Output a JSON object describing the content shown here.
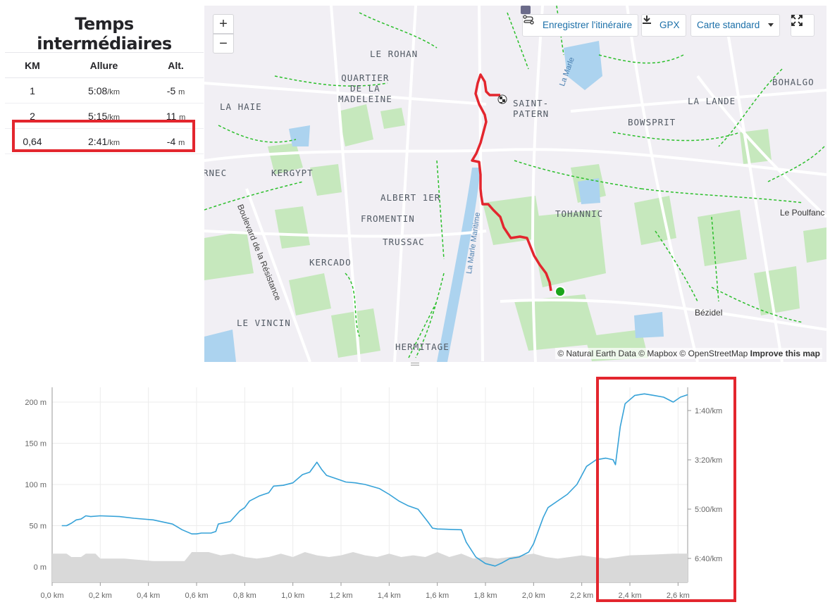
{
  "splits": {
    "title": "Temps intermédiaires",
    "columns": [
      "KM",
      "Allure",
      "Alt."
    ],
    "rows": [
      {
        "km": "1",
        "pace": "5:08",
        "pace_unit": "/km",
        "alt": "-5",
        "alt_unit": "m"
      },
      {
        "km": "2",
        "pace": "5:15",
        "pace_unit": "/km",
        "alt": "11",
        "alt_unit": "m"
      },
      {
        "km": "0,64",
        "pace": "2:41",
        "pace_unit": "/km",
        "alt": "-4",
        "alt_unit": "m"
      }
    ]
  },
  "map": {
    "zoom_in": "+",
    "zoom_out": "−",
    "save_route_label": "Enregistrer l'itinéraire",
    "gpx_label": "GPX",
    "map_style_label": "Carte standard",
    "labels": {
      "le_rohan": "LE ROHAN",
      "quartier": "QUARTIER",
      "de_la": "DE LA",
      "madeleine": "MADELEINE",
      "saint": "SAINT-",
      "patern": "PATERN",
      "bohalgo": "BOHALGO",
      "la_lande": "LA LANDE",
      "bowsprit": "BOWSPRIT",
      "la_haie": "LA HAIE",
      "rnec": "RNEC",
      "kergypt": "KERGYPT",
      "albert": "ALBERT 1ER",
      "fromentin": "FROMENTIN",
      "trussac": "TRUSSAC",
      "kercado": "KERCADO",
      "tohannic": "TOHANNIC",
      "le_poulfanc": "Le Poulfanc",
      "bezidel": "Bézidel",
      "le_vincin": "LE VINCIN",
      "hermitage": "HERMITAGE",
      "boulevard": "Boulevard de la Résistance",
      "la_marle_maritime": "La Marle Maritime",
      "la_marle": "La Marle"
    },
    "attribution": "© Natural Earth Data © Mapbox © OpenStreetMap",
    "improve": "Improve this map",
    "colors": {
      "route": "#e3262e",
      "start": "#1aa51a",
      "park": "#bfe6b6",
      "water": "#aed4f0",
      "path": "#2bbf2b"
    }
  },
  "chart_data": {
    "type": "line",
    "x_unit": "km",
    "xlim": [
      0,
      2.64
    ],
    "x_ticks": [
      "0,0 km",
      "0,2 km",
      "0,4 km",
      "0,6 km",
      "0,8 km",
      "1,0 km",
      "1,2 km",
      "1,4 km",
      "1,6 km",
      "1,8 km",
      "2,0 km",
      "2,2 km",
      "2,4 km",
      "2,6 km"
    ],
    "y_left_ticks": [
      "200 m",
      "150 m",
      "100 m",
      "50 m",
      "0 m"
    ],
    "y_right_ticks": [
      "1:40/km",
      "3:20/km",
      "5:00/km",
      "6:40/km"
    ],
    "ylim": [
      -20,
      220
    ],
    "series": [
      {
        "color": "#36a2d8",
        "points": [
          [
            0.04,
            50
          ],
          [
            0.06,
            50
          ],
          [
            0.08,
            53
          ],
          [
            0.1,
            57
          ],
          [
            0.12,
            58
          ],
          [
            0.14,
            62
          ],
          [
            0.16,
            61
          ],
          [
            0.2,
            62
          ],
          [
            0.28,
            61
          ],
          [
            0.34,
            59
          ],
          [
            0.42,
            57
          ],
          [
            0.5,
            52
          ],
          [
            0.54,
            45
          ],
          [
            0.58,
            40
          ],
          [
            0.6,
            40
          ],
          [
            0.62,
            41
          ],
          [
            0.66,
            41
          ],
          [
            0.68,
            43
          ],
          [
            0.69,
            52
          ],
          [
            0.74,
            55
          ],
          [
            0.78,
            68
          ],
          [
            0.8,
            72
          ],
          [
            0.82,
            80
          ],
          [
            0.86,
            86
          ],
          [
            0.88,
            88
          ],
          [
            0.9,
            90
          ],
          [
            0.92,
            98
          ],
          [
            0.96,
            99
          ],
          [
            1.0,
            102
          ],
          [
            1.04,
            112
          ],
          [
            1.07,
            115
          ],
          [
            1.1,
            127
          ],
          [
            1.12,
            118
          ],
          [
            1.14,
            111
          ],
          [
            1.18,
            107
          ],
          [
            1.22,
            103
          ],
          [
            1.26,
            102
          ],
          [
            1.3,
            100
          ],
          [
            1.36,
            95
          ],
          [
            1.4,
            88
          ],
          [
            1.44,
            80
          ],
          [
            1.48,
            74
          ],
          [
            1.52,
            70
          ],
          [
            1.56,
            55
          ],
          [
            1.58,
            47
          ],
          [
            1.6,
            46
          ],
          [
            1.7,
            45
          ],
          [
            1.72,
            30
          ],
          [
            1.76,
            12
          ],
          [
            1.8,
            4
          ],
          [
            1.84,
            1
          ],
          [
            1.87,
            5
          ],
          [
            1.9,
            10
          ],
          [
            1.94,
            12
          ],
          [
            1.98,
            18
          ],
          [
            2.0,
            28
          ],
          [
            2.04,
            60
          ],
          [
            2.06,
            72
          ],
          [
            2.1,
            80
          ],
          [
            2.14,
            88
          ],
          [
            2.18,
            100
          ],
          [
            2.22,
            122
          ],
          [
            2.26,
            130
          ],
          [
            2.3,
            132
          ],
          [
            2.33,
            130
          ],
          [
            2.34,
            124
          ],
          [
            2.36,
            170
          ],
          [
            2.38,
            198
          ],
          [
            2.42,
            208
          ],
          [
            2.46,
            210
          ],
          [
            2.5,
            208
          ],
          [
            2.54,
            206
          ],
          [
            2.58,
            200
          ],
          [
            2.61,
            206
          ],
          [
            2.64,
            209
          ]
        ]
      }
    ],
    "terrain_color": "#d9d9d9",
    "terrain": [
      [
        0,
        16
      ],
      [
        0.06,
        16
      ],
      [
        0.08,
        12
      ],
      [
        0.12,
        12
      ],
      [
        0.14,
        16
      ],
      [
        0.18,
        16
      ],
      [
        0.2,
        10
      ],
      [
        0.3,
        10
      ],
      [
        0.42,
        7
      ],
      [
        0.55,
        7
      ],
      [
        0.58,
        18
      ],
      [
        0.65,
        18
      ],
      [
        0.7,
        14
      ],
      [
        0.75,
        16
      ],
      [
        0.8,
        12
      ],
      [
        0.85,
        10
      ],
      [
        0.9,
        12
      ],
      [
        0.95,
        16
      ],
      [
        1.0,
        12
      ],
      [
        1.05,
        18
      ],
      [
        1.1,
        14
      ],
      [
        1.15,
        12
      ],
      [
        1.2,
        14
      ],
      [
        1.25,
        18
      ],
      [
        1.3,
        14
      ],
      [
        1.35,
        12
      ],
      [
        1.4,
        16
      ],
      [
        1.45,
        12
      ],
      [
        1.5,
        14
      ],
      [
        1.55,
        12
      ],
      [
        1.6,
        18
      ],
      [
        1.65,
        12
      ],
      [
        1.7,
        16
      ],
      [
        1.75,
        10
      ],
      [
        1.8,
        12
      ],
      [
        1.85,
        10
      ],
      [
        1.9,
        12
      ],
      [
        1.95,
        14
      ],
      [
        2.0,
        16
      ],
      [
        2.05,
        12
      ],
      [
        2.1,
        10
      ],
      [
        2.15,
        12
      ],
      [
        2.2,
        14
      ],
      [
        2.25,
        12
      ],
      [
        2.3,
        10
      ],
      [
        2.35,
        12
      ],
      [
        2.4,
        14
      ],
      [
        2.5,
        15
      ],
      [
        2.58,
        16
      ],
      [
        2.64,
        16
      ]
    ]
  }
}
